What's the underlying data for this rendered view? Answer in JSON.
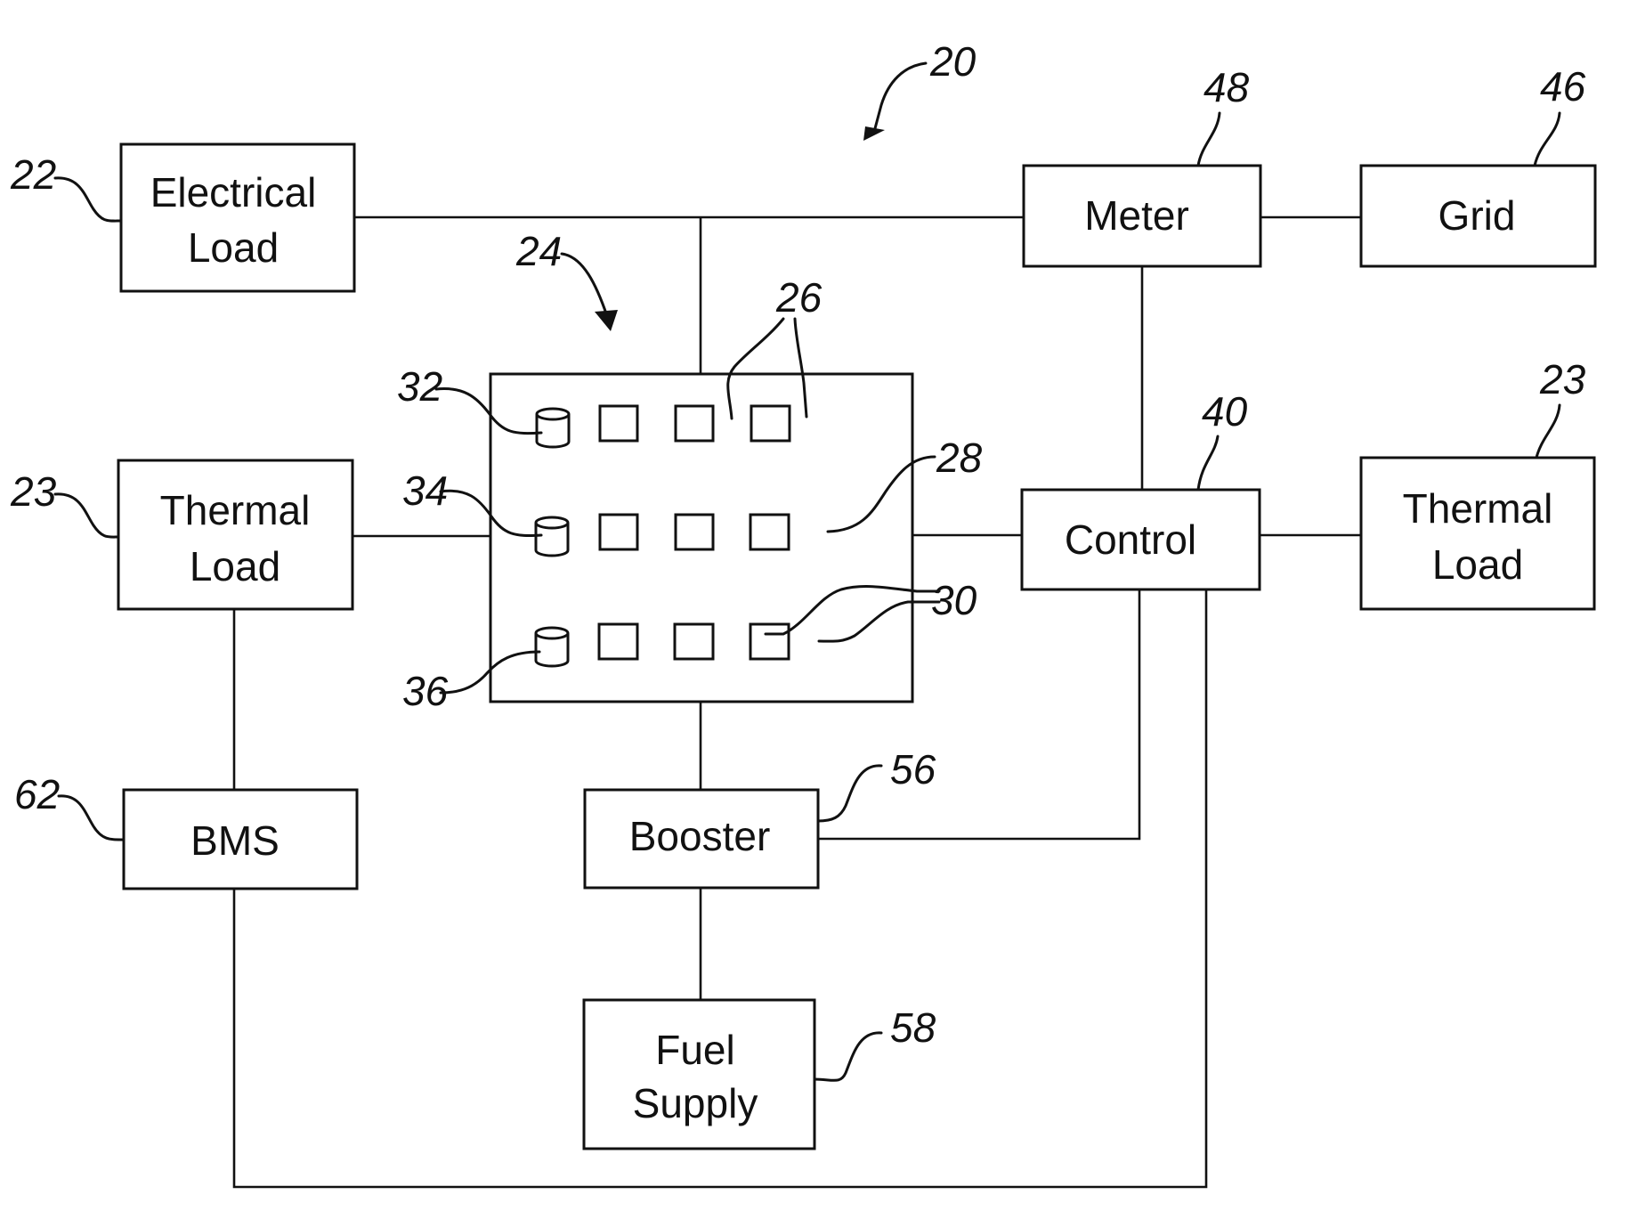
{
  "figure": {
    "system_ref": "20",
    "stack_ref": "24",
    "blocks": {
      "electrical_load": {
        "lines": [
          "Electrical",
          "Load"
        ],
        "ref": "22"
      },
      "thermal_load_left": {
        "lines": [
          "Thermal",
          "Load"
        ],
        "ref": "23"
      },
      "bms": {
        "lines": [
          "BMS"
        ],
        "ref": "62"
      },
      "booster": {
        "lines": [
          "Booster"
        ],
        "ref": "56"
      },
      "fuel_supply": {
        "lines": [
          "Fuel",
          "Supply"
        ],
        "ref": "58"
      },
      "meter": {
        "lines": [
          "Meter"
        ],
        "ref": "48"
      },
      "grid": {
        "lines": [
          "Grid"
        ],
        "ref": "46"
      },
      "control": {
        "lines": [
          "Control"
        ],
        "ref": "40"
      },
      "thermal_load_right": {
        "lines": [
          "Thermal",
          "Load"
        ],
        "ref": "23"
      }
    },
    "stack_refs": {
      "cells": "26",
      "cell_row2": "28",
      "cells_row3": "30",
      "storage_1": "32",
      "storage_2": "34",
      "storage_3": "36"
    },
    "connections": [
      [
        "electrical_load",
        "meter"
      ],
      [
        "stack",
        "electrical_load-meter-bus"
      ],
      [
        "meter",
        "grid"
      ],
      [
        "meter",
        "control"
      ],
      [
        "thermal_load_left",
        "stack"
      ],
      [
        "stack",
        "control"
      ],
      [
        "control",
        "thermal_load_right"
      ],
      [
        "thermal_load_left",
        "bms"
      ],
      [
        "stack",
        "booster"
      ],
      [
        "booster",
        "fuel_supply"
      ],
      [
        "booster",
        "control"
      ],
      [
        "bms",
        "control"
      ]
    ]
  }
}
